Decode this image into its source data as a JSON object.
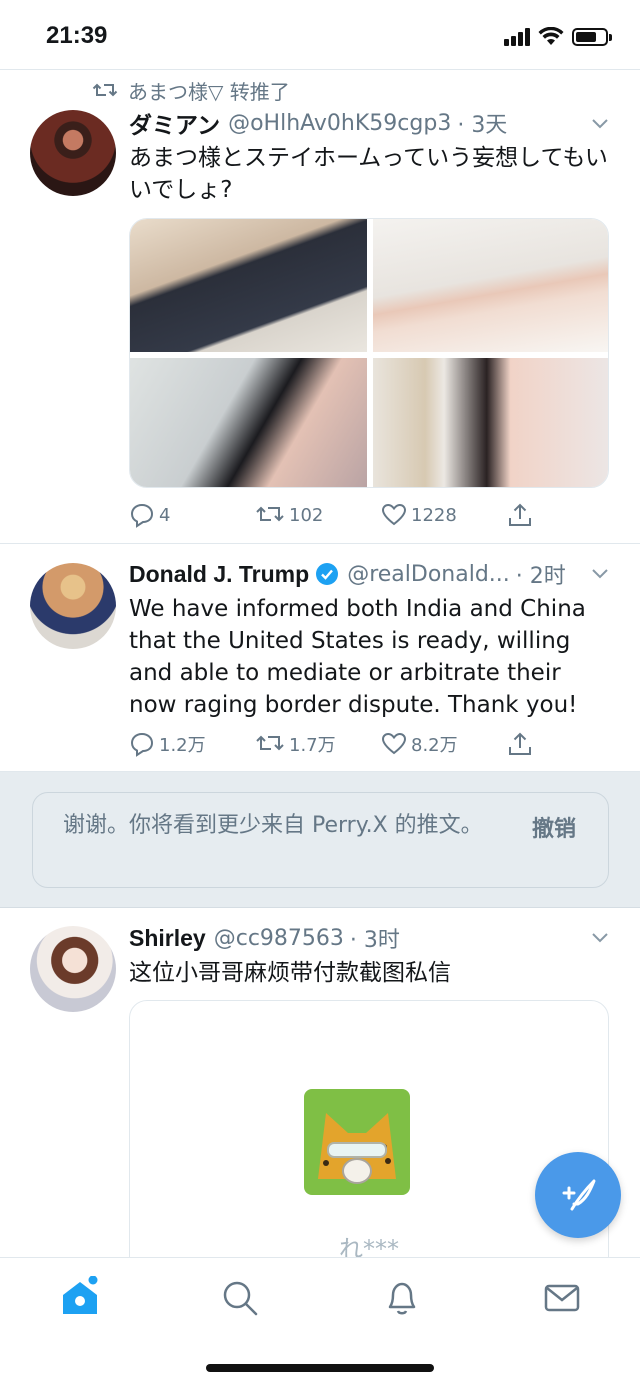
{
  "status_bar": {
    "time": "21:39"
  },
  "tweets": [
    {
      "retweet_by": "あまつ様▽ 转推了",
      "name": "ダミアン",
      "handle": "@oHlhAv0hK59cgp3",
      "time": "· 3天",
      "text": "あまつ様とステイホームっていう妄想してもいいでしょ?",
      "replies": "4",
      "retweets": "102",
      "likes": "1228"
    },
    {
      "name": "Donald J. Trump",
      "handle": "@realDonald...",
      "time": "· 2时",
      "text": "We have informed both India and China that the United States is ready, willing and able to mediate or arbitrate their now raging border dispute. Thank you!",
      "replies": "1.2万",
      "retweets": "1.7万",
      "likes": "8.2万",
      "verified_color": "#1da1f2"
    },
    {
      "name": "Shirley",
      "handle": "@cc987563",
      "time": "· 3时",
      "text": "这位小哥哥麻烦带付款截图私信",
      "card_username": "れ***"
    }
  ],
  "notice": {
    "text": "谢谢。你将看到更少来自 Perry.X 的推文。",
    "undo": "撤销"
  },
  "colors": {
    "accent": "#1da1f2",
    "fab": "#4a99e9",
    "muted": "#657786"
  },
  "icons": [
    "retweet-icon",
    "reply-icon",
    "like-icon",
    "share-icon",
    "chevron-down-icon",
    "compose-icon",
    "home-icon",
    "search-icon",
    "bell-icon",
    "mail-icon"
  ]
}
